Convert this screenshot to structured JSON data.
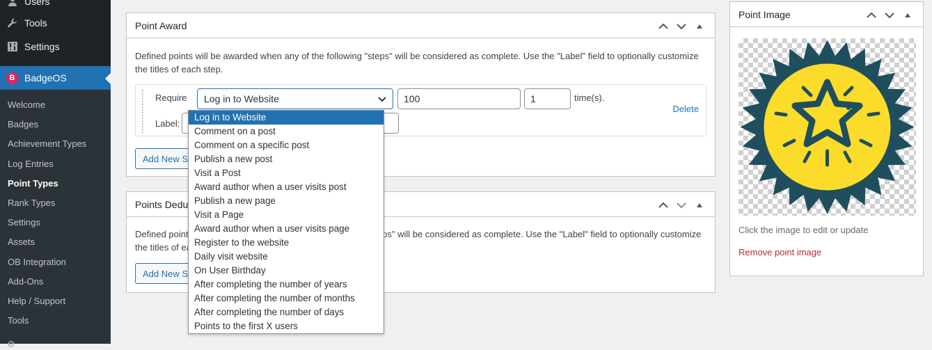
{
  "sidebar": {
    "top_items": [
      {
        "label": "Users",
        "icon": "users-icon"
      },
      {
        "label": "Tools",
        "icon": "wrench-icon"
      },
      {
        "label": "Settings",
        "icon": "settings-icon"
      }
    ],
    "plugin": {
      "label": "BadgeOS",
      "icon_letter": "B"
    },
    "submenu": [
      "Welcome",
      "Badges",
      "Achievement Types",
      "Log Entries",
      "Point Types",
      "Rank Types",
      "Settings",
      "Assets",
      "OB Integration",
      "Add-Ons",
      "Help / Support",
      "Tools"
    ],
    "current": "Point Types"
  },
  "point_award": {
    "title": "Point Award",
    "description": "Defined points will be awarded when any of the following \"steps\" will be considered as complete. Use the \"Label\" field to optionally customize the titles of each step.",
    "require_label": "Require",
    "selected_trigger": "Log in to Website",
    "points_value": "100",
    "times_value": "1",
    "times_suffix": "time(s).",
    "label_label": "Label:",
    "delete_label": "Delete",
    "add_button": "Add New Step"
  },
  "points_deduct": {
    "title": "Points Deduct",
    "description": "Defined points will be deducted when any of the following \"steps\" will be considered as complete. Use the \"Label\" field to optionally customize the titles of each step.",
    "add_button": "Add New Step"
  },
  "dropdown_options": [
    "Log in to Website",
    "Comment on a post",
    "Comment on a specific post",
    "Publish a new post",
    "Visit a Post",
    "Award author when a user visits post",
    "Publish a new page",
    "Visit a Page",
    "Award author when a user visits page",
    "Register to the website",
    "Daily visit website",
    "On User Birthday",
    "After completing the number of years",
    "After completing the number of months",
    "After completing the number of days",
    "Points to the first X users"
  ],
  "point_image": {
    "title": "Point Image",
    "caption": "Click the image to edit or update",
    "remove_label": "Remove point image"
  },
  "colors": {
    "accent": "#2271b1",
    "sidebar_bg": "#1d2327",
    "submenu_bg": "#2c3338",
    "badge_yellow": "#fcdc2a",
    "badge_teal": "#1f4e5f",
    "remove_link": "#b32d2e"
  }
}
